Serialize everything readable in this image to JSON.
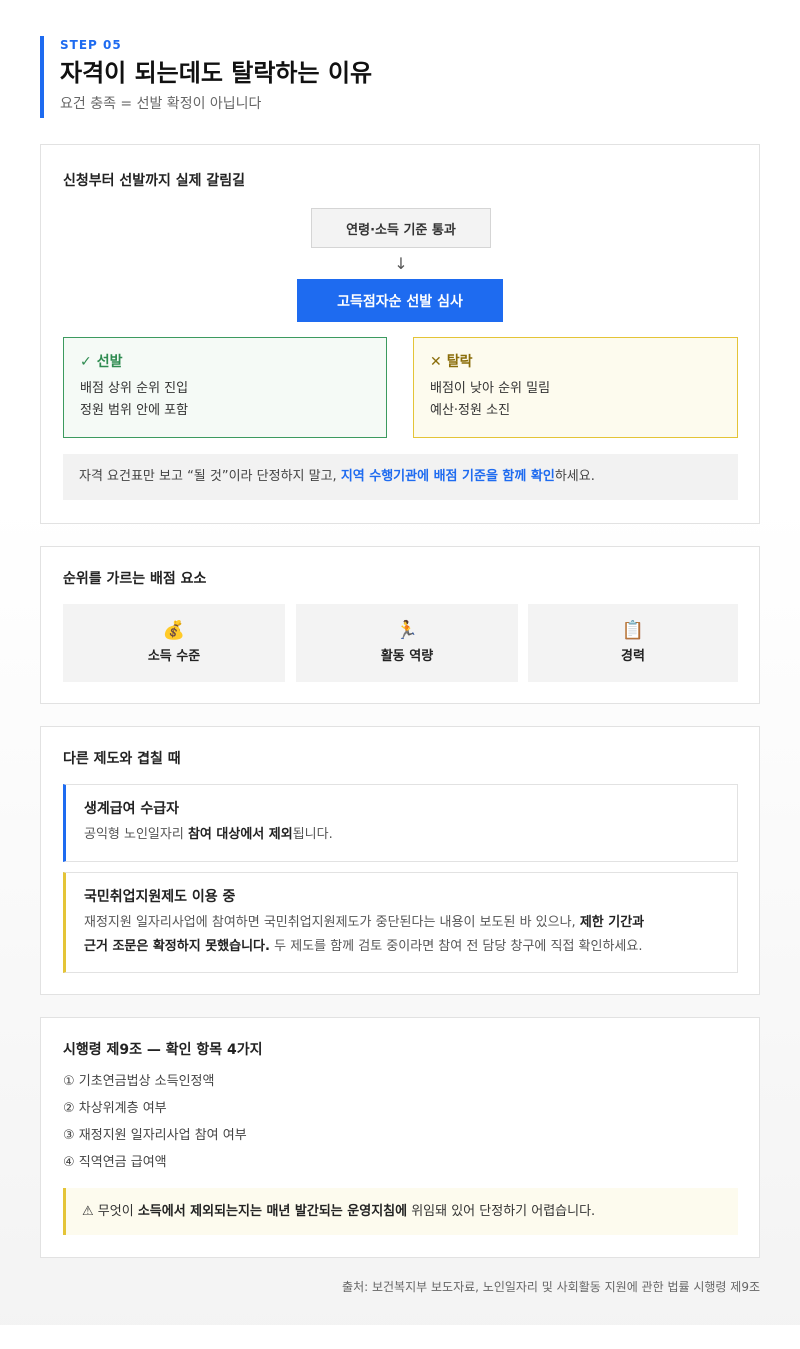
{
  "header": {
    "step": "STEP 05",
    "title": "자격이 되는데도 탈락하는 이유",
    "subtitle": "요건 충족 = 선발 확정이 아닙니다"
  },
  "flow": {
    "title": "신청부터 선발까지 실제 갈림길",
    "box1": "연령·소득 기준 통과",
    "arrow": "↓",
    "box2": "고득점자순 선발 심사",
    "pass": {
      "icon": "✓",
      "label": "선발",
      "lines": [
        "배점 상위 순위 진입",
        "정원 범위 안에 포함"
      ]
    },
    "fail": {
      "icon": "✕",
      "label": "탈락",
      "lines": [
        "배점이 낮아 순위 밀림",
        "예산·정원 소진"
      ]
    },
    "note": {
      "before": "자격 요건표만 보고 “될 것”이라 단정하지 말고, ",
      "highlight": "지역 수행기관에 배점 기준을 함께 확인",
      "after": "하세요."
    }
  },
  "factors": {
    "title": "순위를 가르는 배점 요소",
    "items": [
      {
        "icon": "💰",
        "icon_name": "money-bag-icon",
        "label": "소득 수준"
      },
      {
        "icon": "🏃",
        "icon_name": "runner-icon",
        "label": "활동 역량"
      },
      {
        "icon": "📋",
        "icon_name": "clipboard-icon",
        "label": "경력"
      }
    ]
  },
  "overlap": {
    "title": "다른 제도와 겹칠 때",
    "item1": {
      "head": "생계급여 수급자",
      "body_before": "공익형 노인일자리 ",
      "body_bold": "참여 대상에서 제외",
      "body_after": "됩니다."
    },
    "item2": {
      "head": "국민취업지원제도 이용 중",
      "body_line1_before": "재정지원 일자리사업에 참여하면 국민취업지원제도가 중단된다는 내용이 보도된 바 있으나, ",
      "body_line1_bold": "제한 기간과",
      "body_line2_bold": "근거 조문은 확정하지 못했습니다.",
      "body_line2_after": " 두 제도를 함께 검토 중이라면 참여 전 담당 창구에 직접 확인하세요."
    }
  },
  "decree": {
    "title": "시행령 제9조 — 확인 항목 4가지",
    "items": [
      "① 기초연금법상 소득인정액",
      "② 차상위계층 여부",
      "③ 재정지원 일자리사업 참여 여부",
      "④ 직역연금 급여액"
    ],
    "warning": {
      "icon": "⚠",
      "before": " 무엇이 ",
      "bold": "소득에서 제외되는지는 매년 발간되는 운영지침에",
      "after": " 위임돼 있어 단정하기 어렵습니다."
    }
  },
  "source": "출처: 보건복지부 보도자료, 노인일자리 및 사회활동 지원에 관한 법률 시행령 제9조",
  "colors": {
    "accent": "#1e6bf0",
    "pass": "#2e8b50",
    "warn": "#e4c437"
  }
}
